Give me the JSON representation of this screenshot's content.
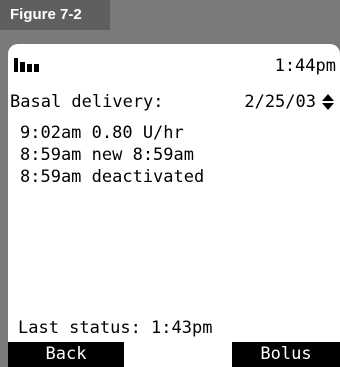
{
  "figure": {
    "label": "Figure 7-2"
  },
  "status_bar": {
    "icon": "signal-strength-icon",
    "time": "1:44pm"
  },
  "basal": {
    "label": "Basal delivery:",
    "date": "2/25/03",
    "scroll_icon": "up-down-arrows-icon"
  },
  "log_entries": [
    {
      "text": "9:02am 0.80 U/hr"
    },
    {
      "text": "8:59am new 8:59am"
    },
    {
      "text": "8:59am deactivated"
    }
  ],
  "last_status": "Last status: 1:43pm",
  "softkeys": {
    "left": "Back",
    "right": "Bolus"
  },
  "colors": {
    "frame": "#7a7a7a",
    "tab": "#5f5f5f",
    "screen": "#ffffff",
    "text": "#000000",
    "softkey_bg": "#000000",
    "softkey_text": "#ffffff"
  }
}
